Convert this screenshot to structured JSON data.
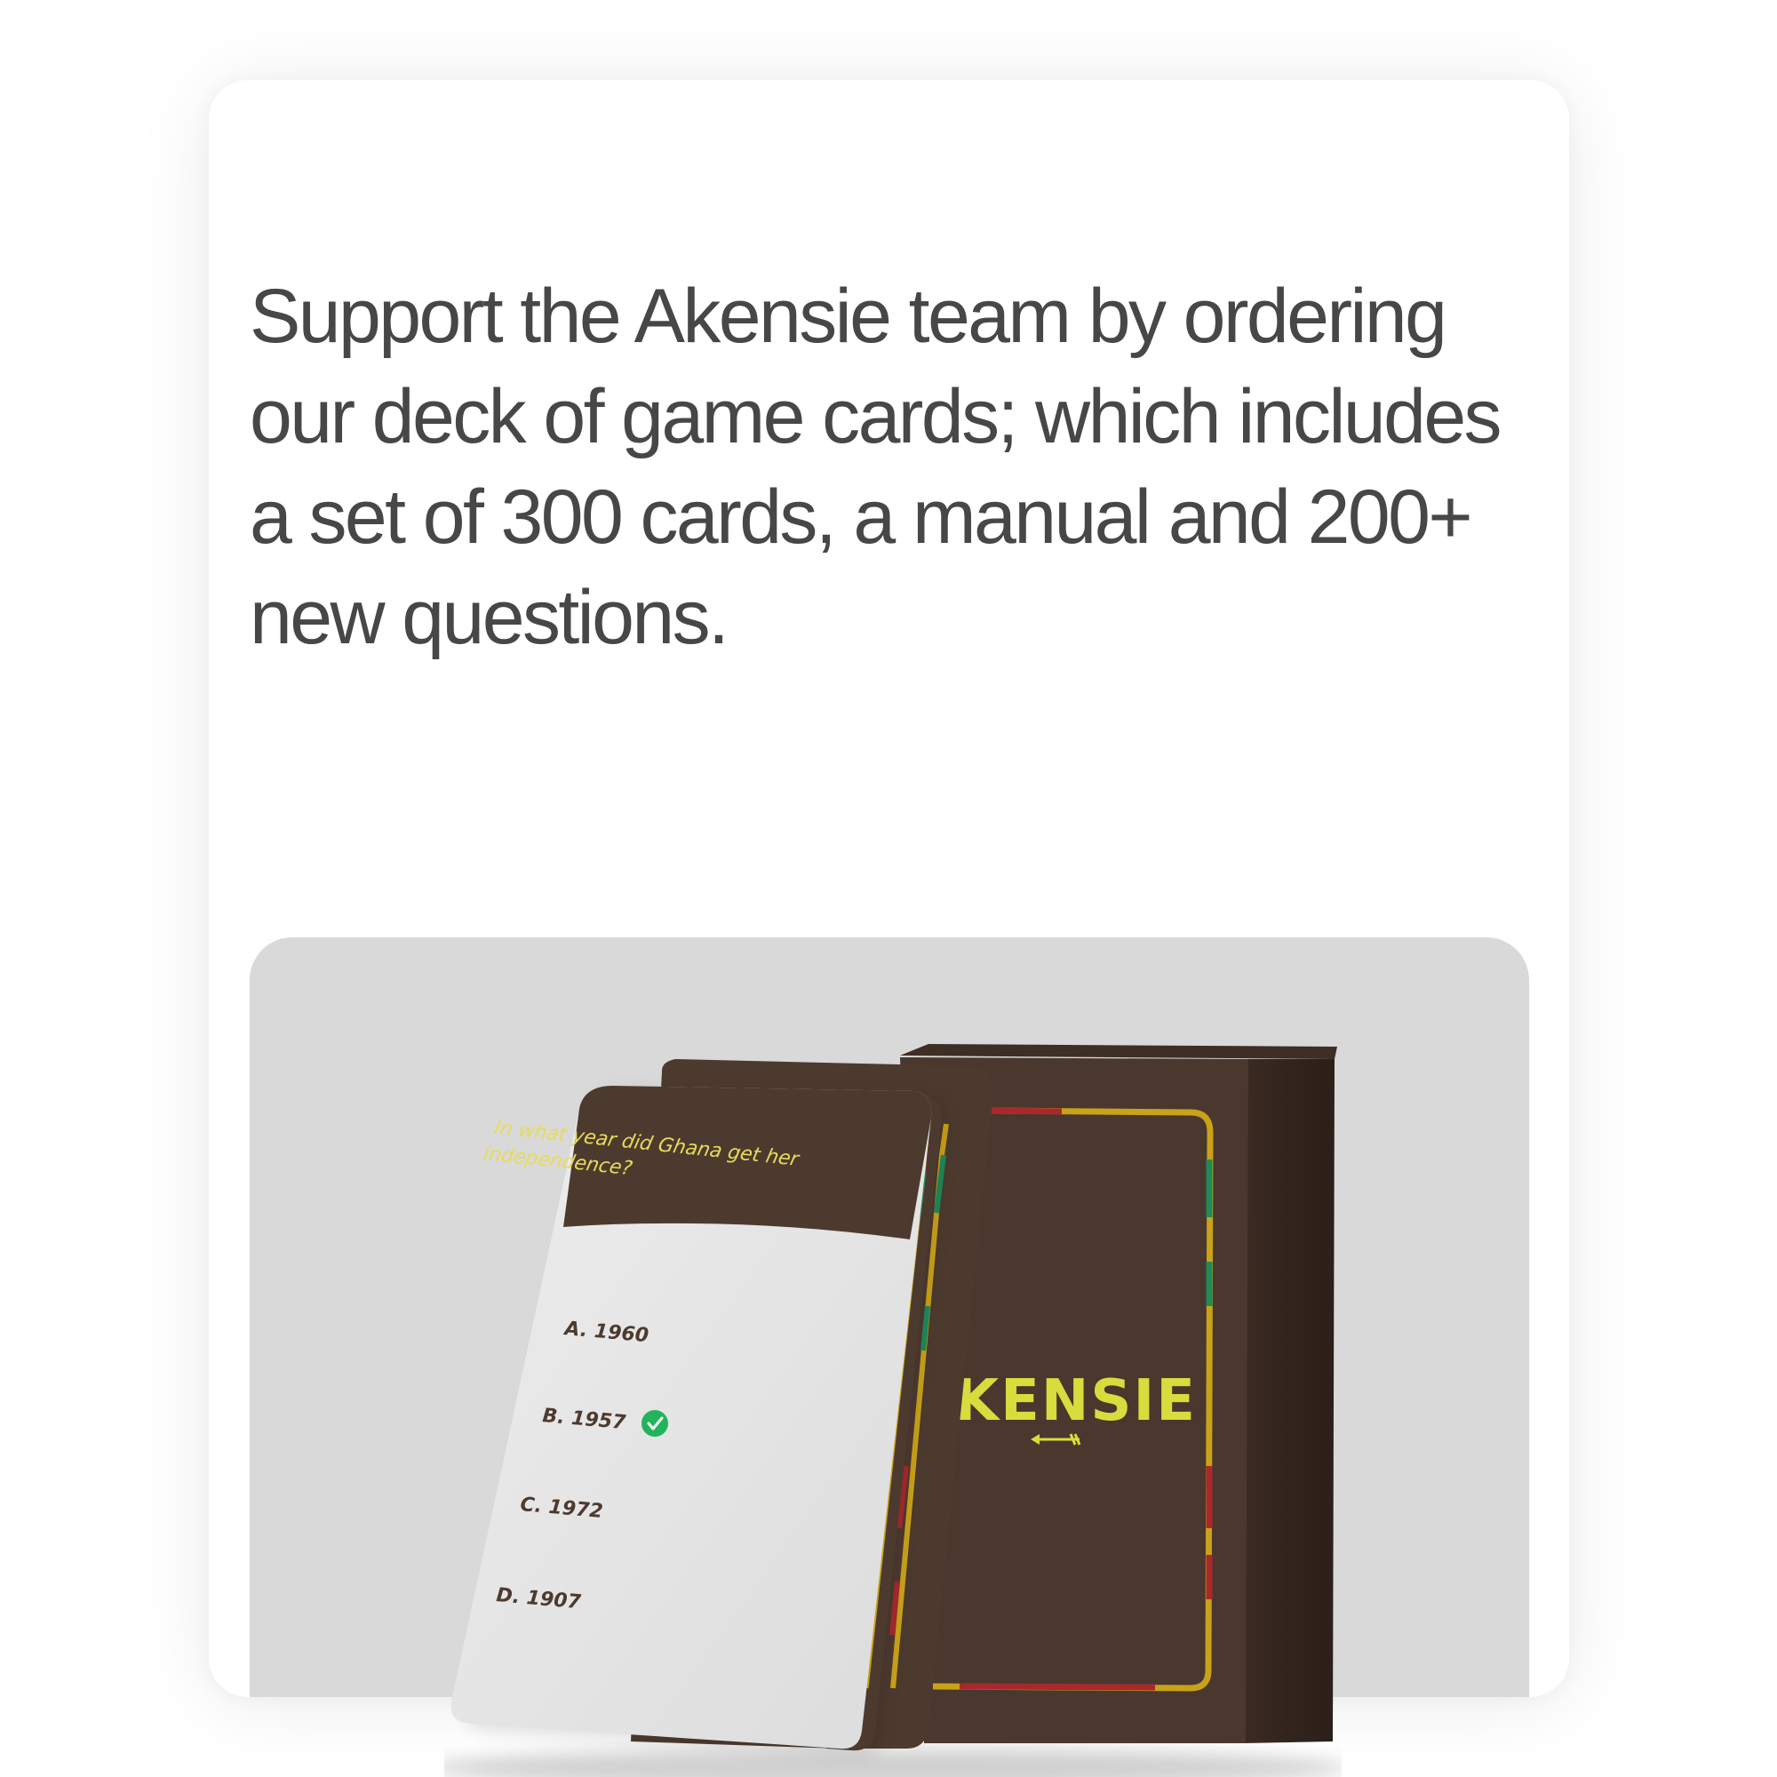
{
  "promo": {
    "headline": "Support the Akensie team by ordering our deck of game cards; which includes a set of 300 cards, a manual and 200+ new questions."
  },
  "product": {
    "box_brand": "AKENSIE",
    "question_card": {
      "question_line1": "In what year did Ghana get her",
      "question_line2": "independence?",
      "options": [
        {
          "label": "A. 1960"
        },
        {
          "label": "B. 1957"
        },
        {
          "label": "C. 1972"
        },
        {
          "label": "D. 1907"
        }
      ],
      "correct_icon": "check-circle-icon"
    },
    "colors": {
      "card_brown": "#4d3a2f",
      "box_brown": "#4a372d",
      "gold": "#c9a21a",
      "red": "#a8292c",
      "green": "#1f8a5a",
      "question_text": "#e6dc5a",
      "brand_text": "#d6dd3c",
      "check_green": "#22b45a",
      "card_face": "#e4e4e4"
    }
  }
}
